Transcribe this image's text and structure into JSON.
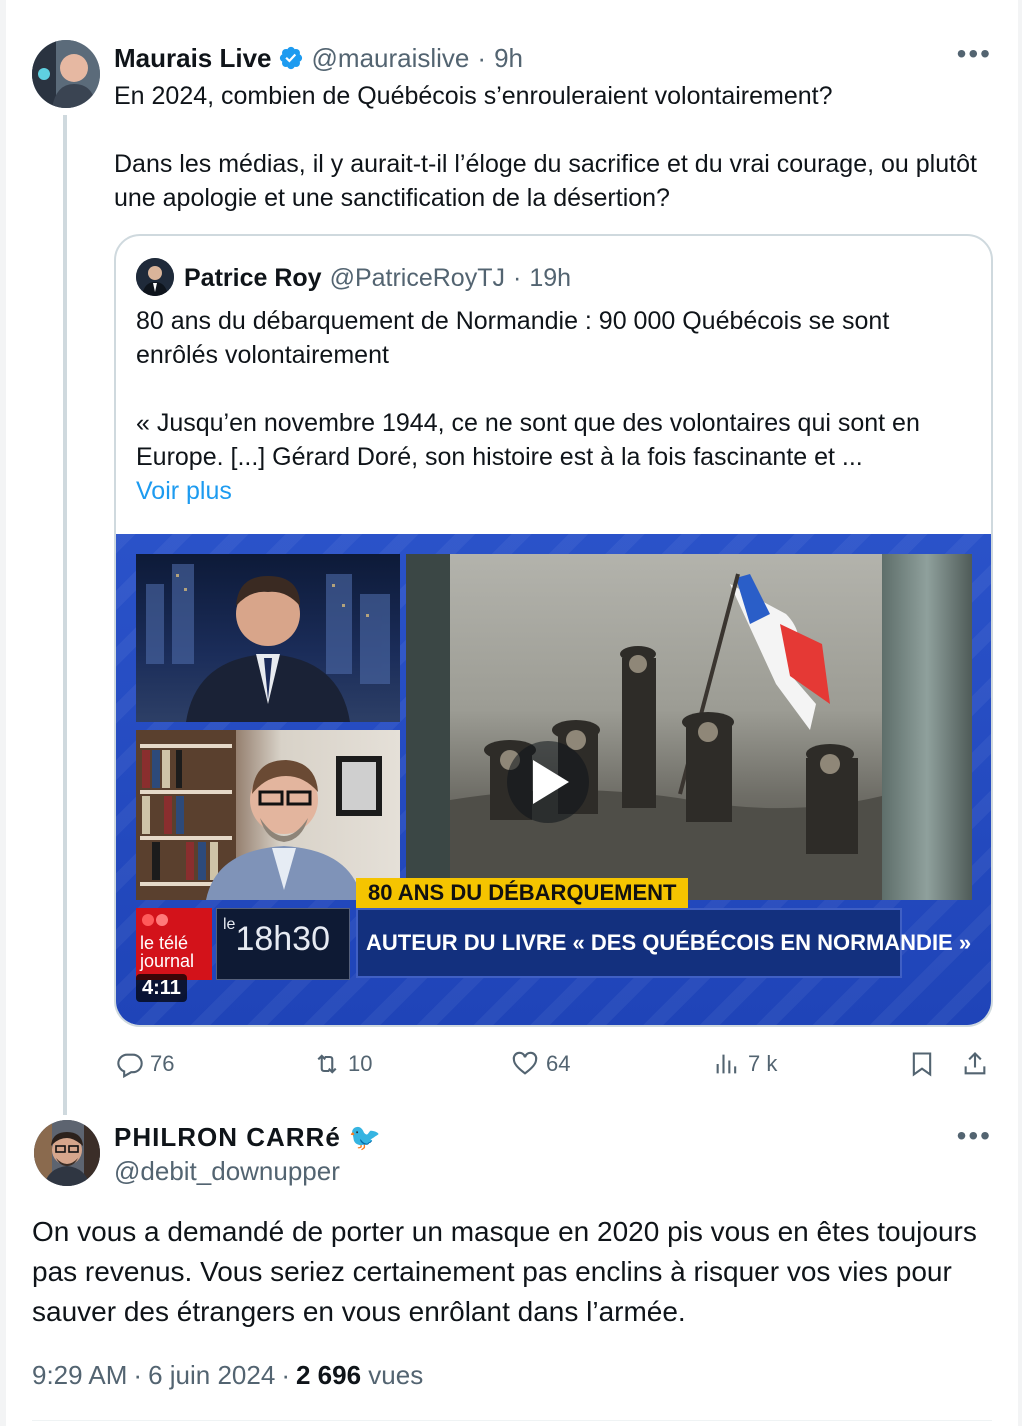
{
  "main_tweet": {
    "author_name": "Maurais Live",
    "handle": "@mauraislive",
    "time": "9h",
    "text_p1": "En 2024, combien de Québécois s’enrouleraient volontairement?",
    "text_p2": "Dans les médias, il y aurait-t-il l’éloge du sacrifice et du vrai courage, ou plutôt une apologie et une sanctification de la désertion?",
    "more_label": "•••"
  },
  "quoted_tweet": {
    "author_name": "Patrice Roy",
    "handle": "@PatriceRoyTJ",
    "time": "19h",
    "text_p1": "80 ans du débarquement de Normandie : 90 000 Québécois se sont enrôlés volontairement",
    "text_p2": "« Jusqu’en novembre 1944, ce ne sont que des volontaires qui sont en Europe. [...] Gérard Doré, son histoire est à la fois fascinante et ...",
    "show_more": "Voir plus",
    "video": {
      "banner_top": "80 ANS DU DÉBARQUEMENT",
      "banner_main": "AUTEUR DU LIVRE « DES QUÉBÉCOIS EN NORMANDIE »",
      "logo_tj": "le télé journal",
      "logo_1830_prefix": "le",
      "logo_1830": "18h30",
      "duration": "4:11"
    }
  },
  "actions": {
    "replies": "76",
    "reposts": "10",
    "likes": "64",
    "views": "7 k"
  },
  "reply": {
    "author_name": "PHILRON CARRé",
    "author_emoji": "🐦",
    "handle": "@debit_downupper",
    "text": "On vous a demandé de porter un masque en 2020 pis vous en êtes toujours pas revenus. Vous seriez certainement pas enclins à risquer vos vies pour sauver des étrangers en vous enrôlant dans l’armée.",
    "more_label": "•••",
    "timestamp": "9:29 AM",
    "date": "6 juin 2024",
    "views_count": "2 696",
    "views_label": "vues"
  },
  "colors": {
    "text": "#0f1419",
    "muted": "#536471",
    "link": "#1d9bf0",
    "verified": "#1d9bf0",
    "border": "#cfd9de",
    "video_bg": "#2a52c9",
    "banner_yellow": "#f5c400"
  }
}
